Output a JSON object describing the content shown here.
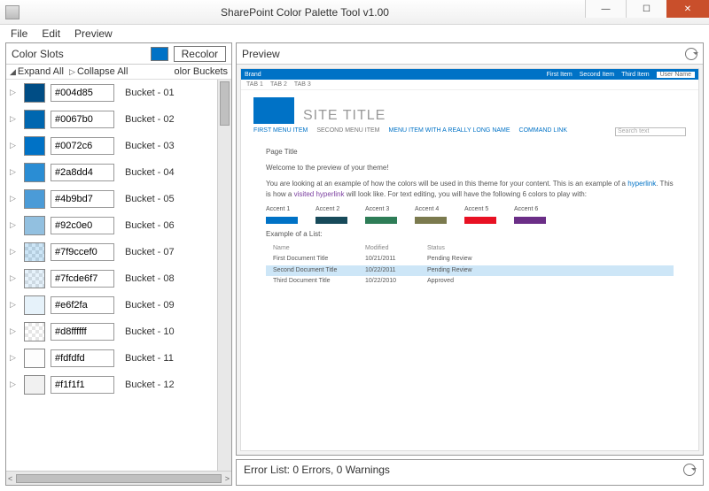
{
  "window": {
    "title": "SharePoint Color Palette Tool v1.00"
  },
  "menu": {
    "file": "File",
    "edit": "Edit",
    "preview": "Preview"
  },
  "left": {
    "header": "Color Slots",
    "recolor": "Recolor",
    "expand": "Expand All",
    "collapse": "Collapse All",
    "column": "olor Buckets",
    "rows": [
      {
        "hex": "#004d85",
        "color": "#004d85",
        "bucket": "Bucket - 01"
      },
      {
        "hex": "#0067b0",
        "color": "#0067b0",
        "bucket": "Bucket - 02"
      },
      {
        "hex": "#0072c6",
        "color": "#0072c6",
        "bucket": "Bucket - 03"
      },
      {
        "hex": "#2a8dd4",
        "color": "#2a8dd4",
        "bucket": "Bucket - 04"
      },
      {
        "hex": "#4b9bd7",
        "color": "#4b9bd7",
        "bucket": "Bucket - 05"
      },
      {
        "hex": "#92c0e0",
        "color": "#92c0e0",
        "bucket": "Bucket - 06"
      },
      {
        "hex": "#7f9ccef0",
        "color": "#9ccef0",
        "bucket": "Bucket - 07",
        "checker": true
      },
      {
        "hex": "#7fcde6f7",
        "color": "#cde6f7",
        "bucket": "Bucket - 08",
        "checker": true
      },
      {
        "hex": "#e6f2fa",
        "color": "#e6f2fa",
        "bucket": "Bucket - 09"
      },
      {
        "hex": "#d8ffffff",
        "color": "#ffffff",
        "bucket": "Bucket - 10",
        "checker": true
      },
      {
        "hex": "#fdfdfd",
        "color": "#fdfdfd",
        "bucket": "Bucket - 11"
      },
      {
        "hex": "#f1f1f1",
        "color": "#f1f1f1",
        "bucket": "Bucket - 12"
      }
    ]
  },
  "preview": {
    "header": "Preview",
    "brand": "Brand",
    "topitems": [
      "First Item",
      "Second Item",
      "Third Item"
    ],
    "user": "User Name",
    "tabs": [
      "TAB 1",
      "TAB 2",
      "TAB 3"
    ],
    "site_title": "SITE TITLE",
    "nav": [
      "FIRST MENU ITEM",
      "SECOND MENU ITEM",
      "MENU ITEM WITH A REALLY LONG NAME",
      "COMMAND LINK"
    ],
    "search_placeholder": "Search text",
    "page_title": "Page Title",
    "welcome": "Welcome to the preview of your theme!",
    "body1a": "You are looking at an example of how the colors will be used in this theme for your content. This is an example of a ",
    "hyperlink": "hyperlink",
    "body1b": ". This is how a ",
    "visited": "visited hyperlink",
    "body1c": " will look like. For text editing, you will have the following 6 colors to play with:",
    "accents": [
      {
        "label": "Accent 1",
        "color": "#0072c6"
      },
      {
        "label": "Accent 2",
        "color": "#174a5a"
      },
      {
        "label": "Accent 3",
        "color": "#2e7d57"
      },
      {
        "label": "Accent 4",
        "color": "#7b7a4e"
      },
      {
        "label": "Accent 5",
        "color": "#e81123"
      },
      {
        "label": "Accent 6",
        "color": "#6b2e87"
      }
    ],
    "list_header": "Example of a List:",
    "cols": [
      "Name",
      "Modified",
      "Status"
    ],
    "docs": [
      {
        "name": "First Document Title",
        "mod": "10/21/2011",
        "status": "Pending Review"
      },
      {
        "name": "Second Document Title",
        "mod": "10/22/2011",
        "status": "Pending Review",
        "selected": true
      },
      {
        "name": "Third Document Title",
        "mod": "10/22/2010",
        "status": "Approved"
      }
    ]
  },
  "errors": {
    "text": "Error List: 0 Errors, 0 Warnings"
  }
}
